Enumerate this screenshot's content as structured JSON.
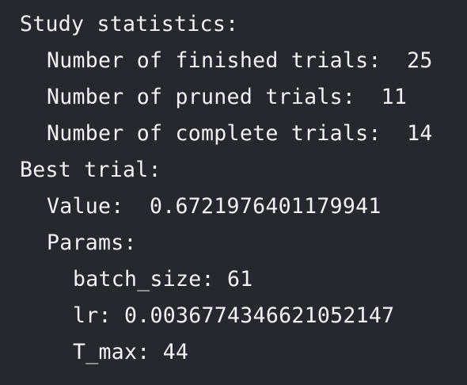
{
  "output": {
    "study_heading": "Study statistics:",
    "finished_trials": "Number of finished trials:  25",
    "pruned_trials": "Number of pruned trials:  11",
    "complete_trials": "Number of complete trials:  14",
    "best_trial_heading": "Best trial:",
    "value_line": "Value:  0.6721976401179941",
    "params_heading": "Params:",
    "batch_size_line": "batch_size: 61",
    "lr_line": "lr: 0.0036774346621052147",
    "t_max_line": "T_max: 44"
  },
  "colors": {
    "background": "#25282f",
    "text": "#f2f3f5"
  }
}
